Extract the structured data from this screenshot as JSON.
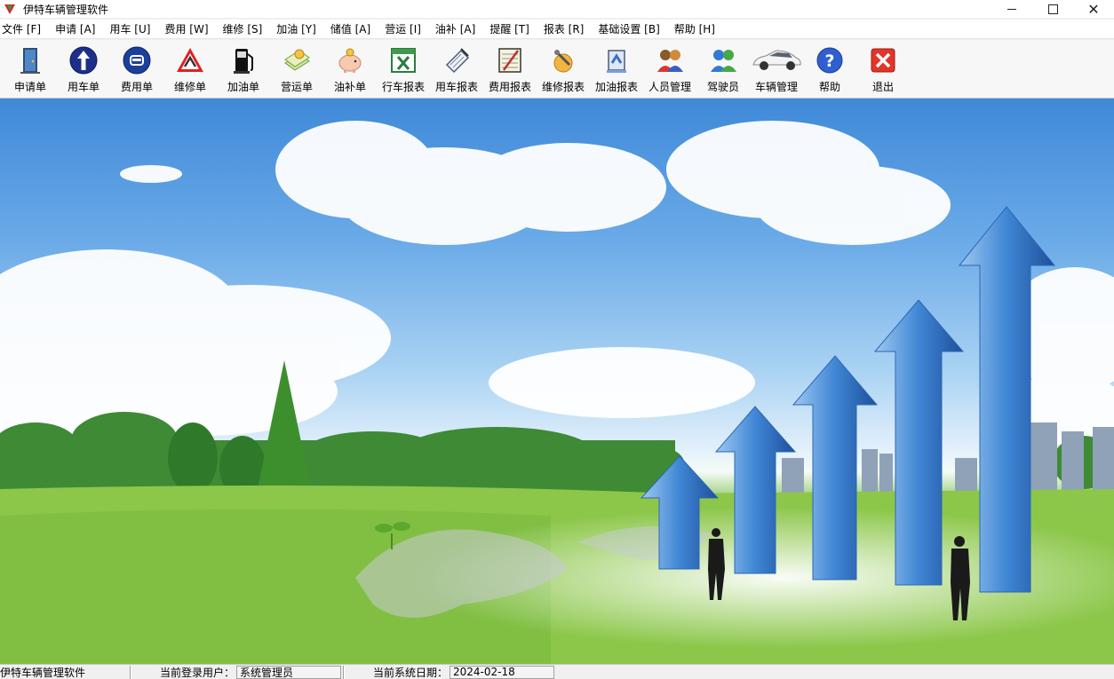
{
  "window": {
    "title": "伊特车辆管理软件",
    "controls": {
      "minimize": "",
      "maximize": "",
      "close": "✕"
    }
  },
  "menu": [
    "文件 [F]",
    "申请 [A]",
    "用车 [U]",
    "费用 [W]",
    "维修 [S]",
    "加油 [Y]",
    "储值 [A]",
    "营运 [I]",
    "油补 [A]",
    "提醒 [T]",
    "报表 [R]",
    "基础设置 [B]",
    "帮助 [H]"
  ],
  "toolbar": [
    {
      "label": "申请单",
      "icon": "door-icon"
    },
    {
      "label": "用车单",
      "icon": "up-arrow-icon"
    },
    {
      "label": "费用单",
      "icon": "car-circle-icon"
    },
    {
      "label": "维修单",
      "icon": "repair-warning-icon"
    },
    {
      "label": "加油单",
      "icon": "fuel-pump-icon"
    },
    {
      "label": "营运单",
      "icon": "money-icon"
    },
    {
      "label": "油补单",
      "icon": "piggy-bank-icon"
    },
    {
      "label": "行车报表",
      "icon": "excel-icon"
    },
    {
      "label": "用车报表",
      "icon": "scroll-icon"
    },
    {
      "label": "费用报表",
      "icon": "notepad-icon"
    },
    {
      "label": "维修报表",
      "icon": "repair-report-icon"
    },
    {
      "label": "加油报表",
      "icon": "fuel-report-icon"
    },
    {
      "label": "人员管理",
      "icon": "people-icon"
    },
    {
      "label": "驾驶员",
      "icon": "drivers-icon"
    },
    {
      "label": "车辆管理",
      "icon": "white-car-icon"
    },
    {
      "label": "帮助",
      "icon": "help-icon"
    },
    {
      "label": "退出",
      "icon": "exit-icon"
    }
  ],
  "statusbar": {
    "app_name": "伊特车辆管理软件",
    "user_label": "当前登录用户：",
    "user_value": "系统管理员",
    "date_label": "当前系统日期：",
    "date_value": "2024-02-18"
  },
  "colors": {
    "toolbar_bg": "#f7f7f7",
    "sky_top": "#3f89d8",
    "grass": "#98cd4f",
    "arrow_blue": "#3f86d4"
  }
}
